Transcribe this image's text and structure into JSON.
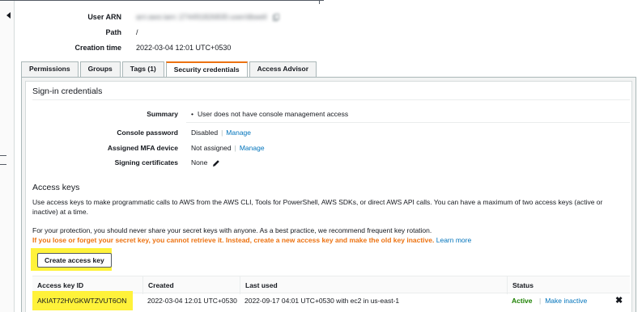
{
  "summary": {
    "user_arn_label": "User ARN",
    "user_arn_value": "arn:aws:iam::274491826835:user/dbwell",
    "path_label": "Path",
    "path_value": "/",
    "creation_time_label": "Creation time",
    "creation_time_value": "2022-03-04 12:01 UTC+0530"
  },
  "tabs": [
    {
      "label": "Permissions"
    },
    {
      "label": "Groups"
    },
    {
      "label": "Tags (1)"
    },
    {
      "label": "Security credentials"
    },
    {
      "label": "Access Advisor"
    }
  ],
  "signin": {
    "title": "Sign-in credentials",
    "summary_label": "Summary",
    "summary_value": "User does not have console management access",
    "console_password_label": "Console password",
    "console_password_value": "Disabled",
    "console_password_link": "Manage",
    "mfa_label": "Assigned MFA device",
    "mfa_value": "Not assigned",
    "mfa_link": "Manage",
    "signing_label": "Signing certificates",
    "signing_value": "None"
  },
  "access_keys": {
    "title": "Access keys",
    "description": "Use access keys to make programmatic calls to AWS from the AWS CLI, Tools for PowerShell, AWS SDKs, or direct AWS API calls. You can have a maximum of two access keys (active or inactive) at a time.",
    "protection": "For your protection, you should never share your secret keys with anyone. As a best practice, we recommend frequent key rotation.",
    "warning": "If you lose or forget your secret key, you cannot retrieve it. Instead, create a new access key and make the old key inactive.",
    "learn_more": "Learn more",
    "create_button": "Create access key",
    "columns": [
      "Access key ID",
      "Created",
      "Last used",
      "Status"
    ],
    "rows": [
      {
        "key_id": "AKIAT72HVGKWTZVUT6ON",
        "created": "2022-03-04 12:01 UTC+0530",
        "last_used": "2022-09-17 04:01 UTC+0530 with ec2 in us-east-1",
        "status": "Active",
        "action": "Make inactive"
      }
    ]
  },
  "colors": {
    "tab_accent": "#ec7211",
    "link": "#0073bb",
    "warning": "#ec7211",
    "active_status": "#1d8102",
    "highlight": "#fff23a"
  },
  "icons": [
    "collapse-arrow-icon",
    "copy-icon",
    "pencil-icon",
    "close-icon"
  ]
}
